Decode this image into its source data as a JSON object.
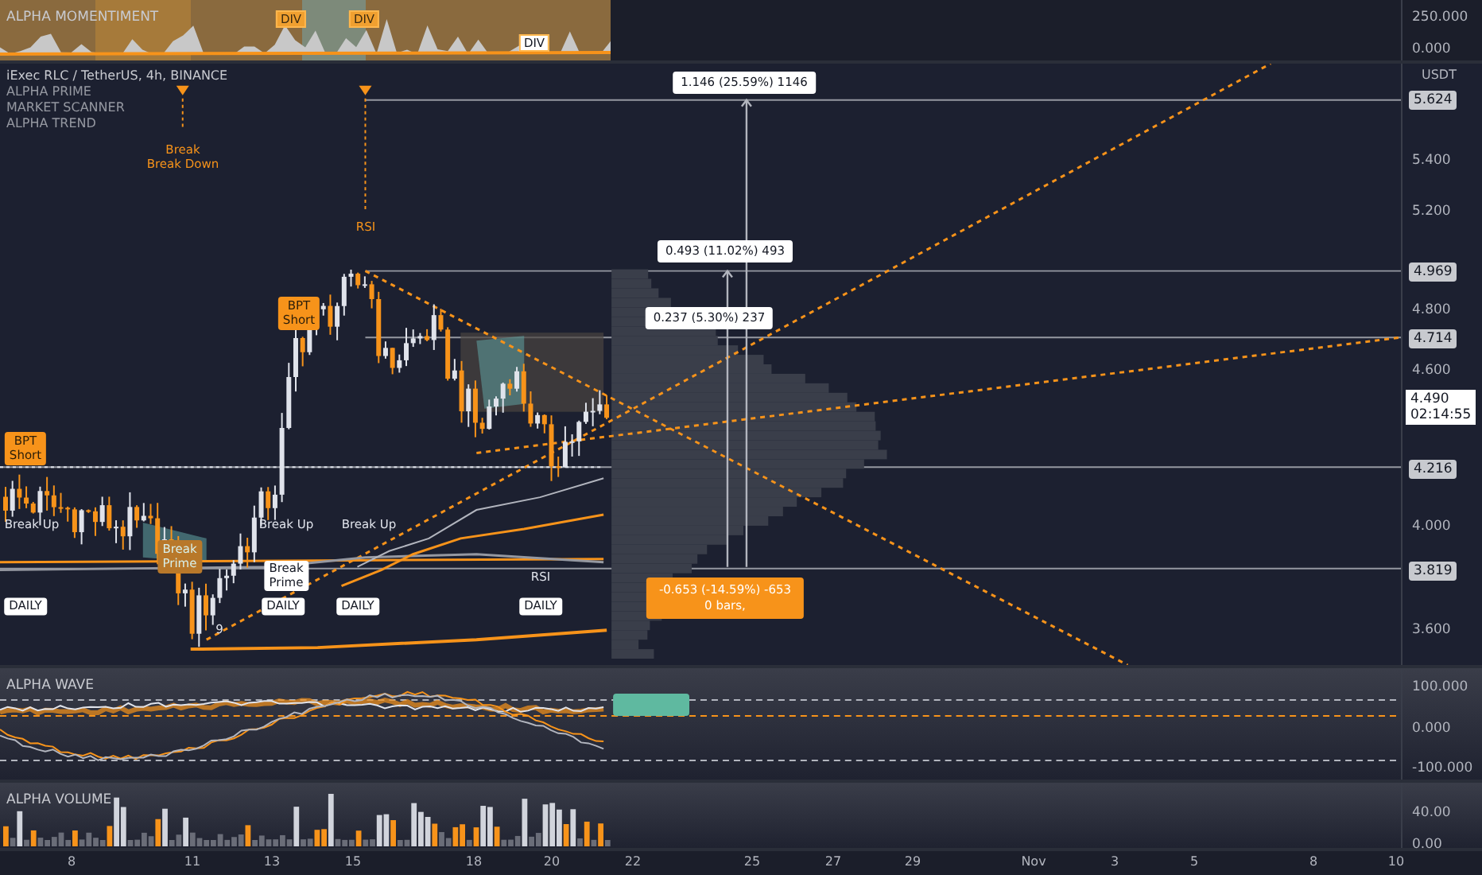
{
  "sentiment_pane": {
    "title": "ALPHA MOMENTIMENT",
    "badges": [
      "DIV",
      "DIV",
      "DIV"
    ],
    "axis_labels": [
      "250.000",
      "0.000"
    ]
  },
  "main_pane": {
    "legend": [
      "iExec RLC / TetherUS, 4h, BINANCE",
      "ALPHA PRIME",
      "MARKET SCANNER",
      "ALPHA TREND"
    ],
    "signals": [
      {
        "kind": "arrow",
        "lines": [
          "Break",
          "Break Down"
        ]
      },
      {
        "kind": "arrow",
        "lines": [
          "RSI"
        ]
      },
      {
        "kind": "tag",
        "lines": [
          "BPT",
          "Short"
        ]
      },
      {
        "kind": "tag",
        "lines": [
          "BPT",
          "Short"
        ]
      },
      {
        "kind": "text",
        "lines": [
          "Break Up"
        ]
      },
      {
        "kind": "text",
        "lines": [
          "Break Up"
        ]
      },
      {
        "kind": "text",
        "lines": [
          "Break Up"
        ]
      },
      {
        "kind": "faded",
        "lines": [
          "Break",
          "Prime"
        ]
      },
      {
        "kind": "box",
        "lines": [
          "Break",
          "Prime"
        ]
      },
      {
        "kind": "text",
        "lines": [
          "RSI"
        ]
      },
      {
        "kind": "box",
        "lines": [
          "DAILY"
        ]
      },
      {
        "kind": "box",
        "lines": [
          "DAILY"
        ]
      },
      {
        "kind": "box",
        "lines": [
          "DAILY"
        ]
      },
      {
        "kind": "box",
        "lines": [
          "DAILY"
        ]
      },
      {
        "kind": "text",
        "lines": [
          "9"
        ]
      }
    ],
    "measures": [
      {
        "kind": "up",
        "lines": [
          "1.146 (25.59%) 1146"
        ]
      },
      {
        "kind": "up",
        "lines": [
          "0.493 (11.02%) 493"
        ]
      },
      {
        "kind": "up",
        "lines": [
          "0.237 (5.30%) 237"
        ]
      },
      {
        "kind": "down",
        "lines": [
          "-0.653 (-14.59%) -653",
          "0 bars,"
        ]
      }
    ],
    "axis_labels": [
      {
        "kind": "unit",
        "lines": [
          "USDT"
        ]
      },
      {
        "kind": "level",
        "lines": [
          "5.624"
        ]
      },
      {
        "kind": "plain",
        "lines": [
          "5.400"
        ]
      },
      {
        "kind": "plain",
        "lines": [
          "5.200"
        ]
      },
      {
        "kind": "level",
        "lines": [
          "4.969"
        ]
      },
      {
        "kind": "plain",
        "lines": [
          "4.800"
        ]
      },
      {
        "kind": "level",
        "lines": [
          "4.714"
        ]
      },
      {
        "kind": "plain",
        "lines": [
          "4.600"
        ]
      },
      {
        "kind": "current",
        "lines": [
          "4.490",
          "02:14:55"
        ]
      },
      {
        "kind": "level",
        "lines": [
          "4.216"
        ]
      },
      {
        "kind": "plain",
        "lines": [
          "4.000"
        ]
      },
      {
        "kind": "level",
        "lines": [
          "3.819"
        ]
      },
      {
        "kind": "plain",
        "lines": [
          "3.600"
        ]
      }
    ]
  },
  "wave_pane": {
    "title": "ALPHA WAVE",
    "axis_labels": [
      "100.000",
      "0.000",
      "-100.000"
    ]
  },
  "volume_pane": {
    "title": "ALPHA VOLUME",
    "axis_labels": [
      "40.00",
      "0.00"
    ]
  },
  "time_axis": [
    "8",
    "11",
    "13",
    "15",
    "18",
    "20",
    "22",
    "25",
    "27",
    "29",
    "Nov",
    "3",
    "5",
    "8",
    "10"
  ]
}
